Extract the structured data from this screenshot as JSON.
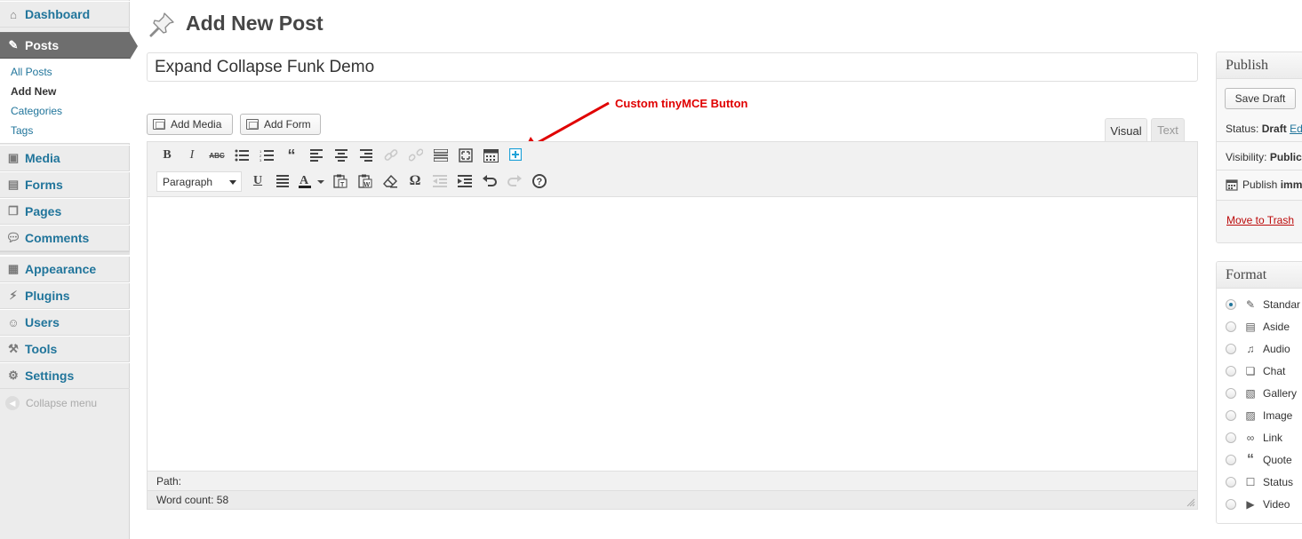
{
  "sidebar": {
    "items": [
      {
        "label": "Dashboard",
        "icon": "dashboard-icon"
      },
      {
        "label": "Posts",
        "icon": "pin-icon"
      },
      {
        "label": "Media",
        "icon": "media-icon"
      },
      {
        "label": "Forms",
        "icon": "forms-icon"
      },
      {
        "label": "Pages",
        "icon": "pages-icon"
      },
      {
        "label": "Comments",
        "icon": "comment-icon"
      },
      {
        "label": "Appearance",
        "icon": "appearance-icon"
      },
      {
        "label": "Plugins",
        "icon": "plugin-icon"
      },
      {
        "label": "Users",
        "icon": "users-icon"
      },
      {
        "label": "Tools",
        "icon": "tools-icon"
      },
      {
        "label": "Settings",
        "icon": "settings-icon"
      }
    ],
    "submenu": [
      "All Posts",
      "Add New",
      "Categories",
      "Tags"
    ],
    "collapse_label": "Collapse menu"
  },
  "header": {
    "title": "Add New Post"
  },
  "post": {
    "title_value": "Expand Collapse Funk Demo"
  },
  "media_buttons": {
    "add_media": "Add Media",
    "add_form": "Add Form"
  },
  "annotation": {
    "text": "Custom tinyMCE Button",
    "color": "#e00000"
  },
  "editor_tabs": {
    "visual": "Visual",
    "text": "Text"
  },
  "toolbar": {
    "format_select": "Paragraph",
    "row1": [
      "bold-icon",
      "italic-icon",
      "strikethrough-icon",
      "bullet-list-icon",
      "numbered-list-icon",
      "blockquote-icon",
      "align-left-icon",
      "align-center-icon",
      "align-right-icon",
      "link-icon",
      "unlink-icon",
      "more-tag-icon",
      "fullscreen-icon",
      "kitchen-sink-icon",
      "custom-plus-icon"
    ],
    "row2": [
      "underline-icon",
      "justify-icon",
      "text-color-icon",
      "paste-text-icon",
      "paste-word-icon",
      "clear-format-icon",
      "special-char-icon",
      "outdent-icon",
      "indent-icon",
      "undo-icon",
      "redo-icon",
      "help-icon"
    ]
  },
  "status": {
    "path_label": "Path:",
    "word_count": "Word count: 58"
  },
  "publish": {
    "title": "Publish",
    "save_draft": "Save Draft",
    "status_label": "Status:",
    "status_value": "Draft",
    "status_edit": "Ed",
    "visibility_label": "Visibility:",
    "visibility_value": "Public",
    "publish_label": "Publish",
    "publish_value": "imm",
    "trash": "Move to Trash"
  },
  "format": {
    "title": "Format",
    "options": [
      "Standar",
      "Aside",
      "Audio",
      "Chat",
      "Gallery",
      "Image",
      "Link",
      "Quote",
      "Status",
      "Video"
    ],
    "selected": "Standar"
  },
  "colors": {
    "link": "#21759b",
    "current_menu": "#6e6e6e",
    "trash": "#bc0b0b",
    "custom_button": "#21a2d8"
  }
}
